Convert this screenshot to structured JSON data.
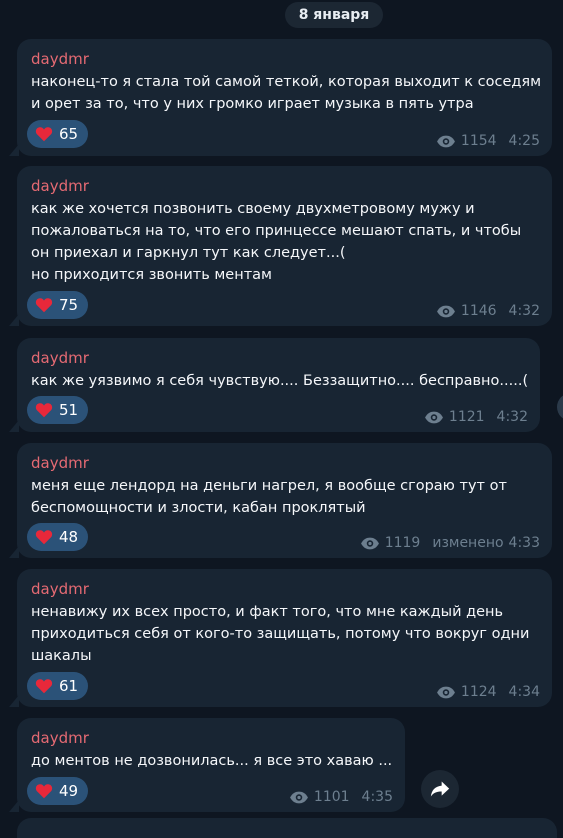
{
  "date_label": "8 января",
  "colors": {
    "background": "#0e1621",
    "bubble": "#182533",
    "author": "#e56a73",
    "reaction_pill": "#2b5278",
    "heart": "#e8283a",
    "meta": "#6d7f8f"
  },
  "icons": {
    "reaction": "heart-icon",
    "views": "eye-icon",
    "share": "share-arrow-icon"
  },
  "messages": [
    {
      "author": "daydmr",
      "text": "наконец-то я стала той самой теткой, которая выходит к соседям\nи орет за то, что у них громко играет музыка в пять утра",
      "reaction_count": "65",
      "views": "1154",
      "edited": "",
      "time": "4:25"
    },
    {
      "author": "daydmr",
      "text": "как же хочется позвонить своему двухметровому мужу и\nпожаловаться на то, что его принцессе мешают спать, и чтобы\nон приехал и гаркнул тут как следует...(\nно приходится звонить ментам",
      "reaction_count": "75",
      "views": "1146",
      "edited": "",
      "time": "4:32"
    },
    {
      "author": "daydmr",
      "text": "как же уязвимо я себя чувствую.... Беззащитно.... бесправно.....(",
      "reaction_count": "51",
      "views": "1121",
      "edited": "",
      "time": "4:32"
    },
    {
      "author": "daydmr",
      "text": "меня еще лендорд на деньги нагрел, я вообще сгораю тут от\nбеспомощности и злости, кабан проклятый",
      "reaction_count": "48",
      "views": "1119",
      "edited": "изменено",
      "time": "4:33"
    },
    {
      "author": "daydmr",
      "text": "ненавижу их всех просто, и факт того, что мне каждый день\nприходиться себя от кого-то защищать, потому что вокруг одни\nшакалы",
      "reaction_count": "61",
      "views": "1124",
      "edited": "",
      "time": "4:34"
    },
    {
      "author": "daydmr",
      "text": "до ментов не дозвонилась... я все это хаваю ...",
      "reaction_count": "49",
      "views": "1101",
      "edited": "",
      "time": "4:35"
    }
  ]
}
